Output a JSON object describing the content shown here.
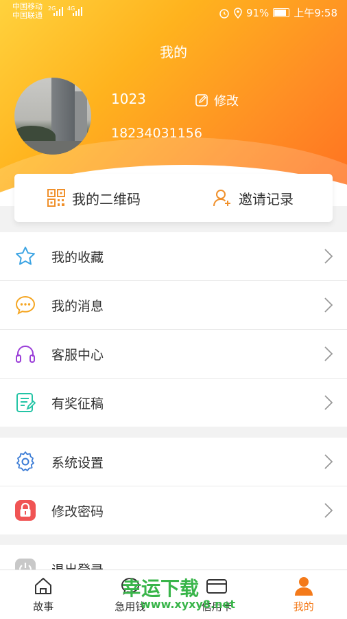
{
  "status_bar": {
    "carrier1": "中国移动",
    "carrier2": "中国联通",
    "net1": "2G",
    "net2": "4G",
    "battery": "91%",
    "battery_level": 0.91,
    "time": "上午9:58"
  },
  "header": {
    "title": "我的",
    "username": "1023",
    "edit_label": "修改",
    "phone": "18234031156"
  },
  "quick_actions": [
    {
      "label": "我的二维码",
      "icon": "qr-code-icon"
    },
    {
      "label": "邀请记录",
      "icon": "add-user-icon"
    }
  ],
  "menu_group1": [
    {
      "label": "我的收藏",
      "icon": "star-icon",
      "color": "#3aa3e3"
    },
    {
      "label": "我的消息",
      "icon": "chat-bubble-icon",
      "color": "#f5a623"
    },
    {
      "label": "客服中心",
      "icon": "headphones-icon",
      "color": "#9b3fd8"
    },
    {
      "label": "有奖征稿",
      "icon": "edit-document-icon",
      "color": "#23c4a5"
    }
  ],
  "menu_group2": [
    {
      "label": "系统设置",
      "icon": "gear-icon",
      "color": "#3a7bd5"
    },
    {
      "label": "修改密码",
      "icon": "lock-icon",
      "color": "#f05454"
    }
  ],
  "menu_group3": [
    {
      "label": "退出登录",
      "icon": "power-icon",
      "color": "#bbbbbb"
    }
  ],
  "tabs": [
    {
      "label": "故事",
      "icon": "home-icon"
    },
    {
      "label": "急用钱",
      "icon": "money-bubble-icon"
    },
    {
      "label": "信用卡",
      "icon": "credit-card-icon"
    },
    {
      "label": "我的",
      "icon": "person-icon",
      "active": true
    }
  ],
  "watermark": {
    "text": "幸运下载",
    "url": "www.xyxy8.net"
  },
  "colors": {
    "accent": "#f47a1a",
    "header_start": "#ffd23d",
    "header_end": "#ff6f21"
  }
}
